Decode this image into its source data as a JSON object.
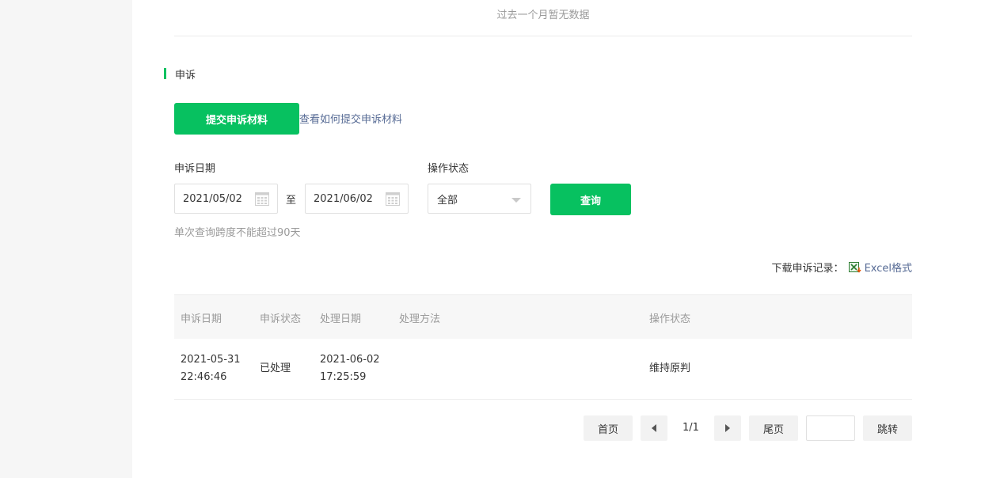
{
  "top": {
    "no_data_text": "过去一个月暂无数据"
  },
  "appeal": {
    "section_title": "申诉",
    "submit_button": "提交申诉材料",
    "help_link": "查看如何提交申诉材料"
  },
  "filters": {
    "date_label": "申诉日期",
    "date_start": "2021/05/02",
    "date_separator": "至",
    "date_end": "2021/06/02",
    "status_label": "操作状态",
    "status_value": "全部",
    "query_button": "查询",
    "hint": "单次查询跨度不能超过90天"
  },
  "download": {
    "label": "下载申诉记录：",
    "link": "Excel格式",
    "icon": "excel-icon"
  },
  "table": {
    "headers": [
      "申诉日期",
      "申诉状态",
      "处理日期",
      "处理方法",
      "操作状态"
    ],
    "rows": [
      [
        "2021-05-31 22:46:46",
        "已处理",
        "2021-06-02 17:25:59",
        "",
        "维持原判"
      ]
    ]
  },
  "pagination": {
    "first": "首页",
    "page_info": "1/1",
    "last": "尾页",
    "jump_value": "",
    "jump": "跳转"
  },
  "colors": {
    "accent": "#07c160",
    "link": "#576b95",
    "muted_text": "#9a9a9a",
    "sidebar_bg": "#f6f6f6"
  }
}
